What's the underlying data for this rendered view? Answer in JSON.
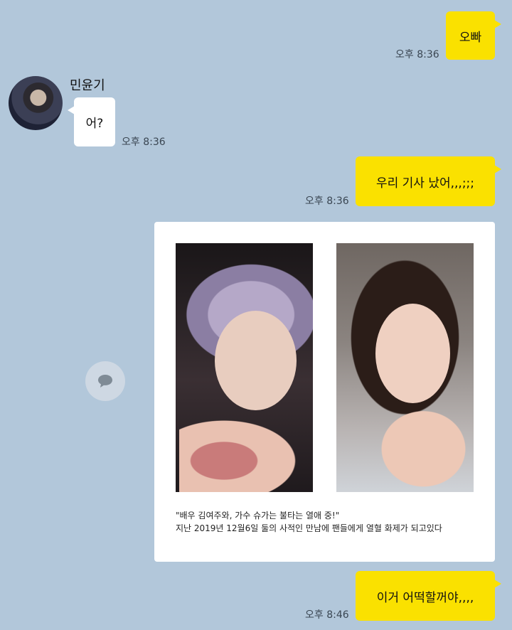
{
  "messages": [
    {
      "id": "m1",
      "sender": "me",
      "text": "오빠",
      "time": "오후 8:36"
    },
    {
      "id": "m2",
      "sender": "민윤기",
      "text": "어?",
      "time": "오후 8:36"
    },
    {
      "id": "m3",
      "sender": "me",
      "text": "우리 기사 났어,,,;;;",
      "time": "오후 8:36"
    },
    {
      "id": "m4",
      "sender": "me",
      "type": "image",
      "caption_line1": "\"배우 김여주와, 가수 슈가는 불타는 열애 중!\"",
      "caption_line2": "지난 2019년 12월6일 둘의 사적인 만남에 팬들에게 열혈 화제가 되고있다"
    },
    {
      "id": "m5",
      "sender": "me",
      "text": "이거 어떡할꺼야,,,,",
      "time": "오후 8:46"
    }
  ],
  "contact": {
    "name": "민윤기"
  },
  "icons": {
    "share": "speech-bubble-icon"
  },
  "colors": {
    "background": "#b2c7da",
    "my_bubble": "#fae100",
    "other_bubble": "#ffffff"
  }
}
